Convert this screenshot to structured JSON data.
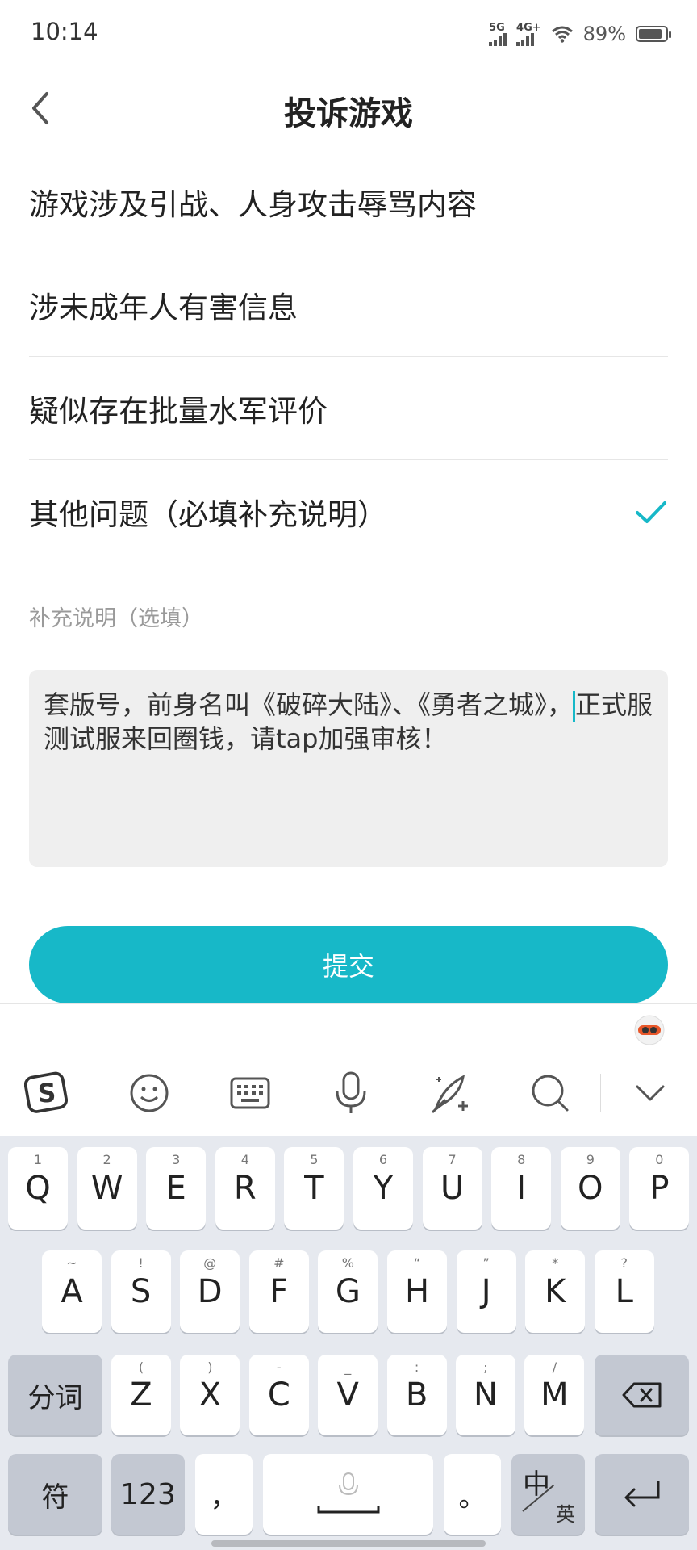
{
  "status_bar": {
    "time": "10:14",
    "signal1_tag": "5G",
    "signal2_tag": "4G+",
    "battery_text": "89%",
    "battery_level": 0.89
  },
  "header": {
    "title": "投诉游戏",
    "back_icon": "chevron-left-icon"
  },
  "options": [
    {
      "label": "游戏涉及引战、人身攻击辱骂内容",
      "selected": false
    },
    {
      "label": "涉未成年人有害信息",
      "selected": false
    },
    {
      "label": "疑似存在批量水军评价",
      "selected": false
    },
    {
      "label": "其他问题（必填补充说明）",
      "selected": true
    }
  ],
  "supplement": {
    "label": "补充说明（选填）",
    "text_before_cursor": "套版号，前身名叫《破碎大陆》、《勇者之城》，",
    "text_after_cursor": "正式服测试服来回圈钱，请tap加强审核！"
  },
  "submit_label": "提交",
  "colors": {
    "accent": "#17b8c8"
  },
  "keyboard": {
    "toolbar_icons": [
      "sogou-logo-icon",
      "emoji-icon",
      "keyboard-icon",
      "microphone-icon",
      "handwriting-icon",
      "search-icon",
      "chevron-down-icon"
    ],
    "row1": [
      {
        "main": "Q",
        "sub": "1"
      },
      {
        "main": "W",
        "sub": "2"
      },
      {
        "main": "E",
        "sub": "3"
      },
      {
        "main": "R",
        "sub": "4"
      },
      {
        "main": "T",
        "sub": "5"
      },
      {
        "main": "Y",
        "sub": "6"
      },
      {
        "main": "U",
        "sub": "7"
      },
      {
        "main": "I",
        "sub": "8"
      },
      {
        "main": "O",
        "sub": "9"
      },
      {
        "main": "P",
        "sub": "0"
      }
    ],
    "row2": [
      {
        "main": "A",
        "sub": "~"
      },
      {
        "main": "S",
        "sub": "!"
      },
      {
        "main": "D",
        "sub": "@"
      },
      {
        "main": "F",
        "sub": "#"
      },
      {
        "main": "G",
        "sub": "%"
      },
      {
        "main": "H",
        "sub": "“"
      },
      {
        "main": "J",
        "sub": "”"
      },
      {
        "main": "K",
        "sub": "*"
      },
      {
        "main": "L",
        "sub": "?"
      }
    ],
    "row3_left": "分词",
    "row3": [
      {
        "main": "Z",
        "sub": "("
      },
      {
        "main": "X",
        "sub": ")"
      },
      {
        "main": "C",
        "sub": "-"
      },
      {
        "main": "V",
        "sub": "_"
      },
      {
        "main": "B",
        "sub": ":"
      },
      {
        "main": "N",
        "sub": ";"
      },
      {
        "main": "M",
        "sub": "/"
      }
    ],
    "row4": {
      "symbols": "符",
      "numbers": "123",
      "comma": "，",
      "period": "。",
      "lang_main": "中",
      "lang_sub": "英"
    }
  }
}
